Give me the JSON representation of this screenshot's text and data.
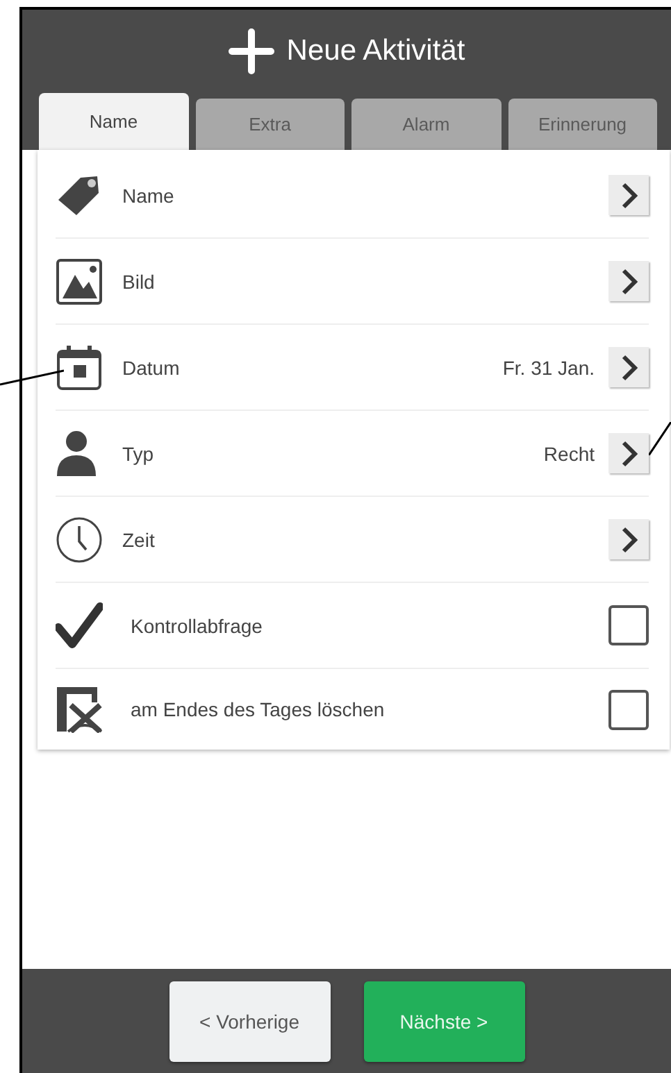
{
  "header": {
    "title": "Neue Aktivität"
  },
  "tabs": [
    {
      "label": "Name",
      "selected": true
    },
    {
      "label": "Extra",
      "selected": false
    },
    {
      "label": "Alarm",
      "selected": false
    },
    {
      "label": "Erinnerung",
      "selected": false
    }
  ],
  "rows": [
    {
      "kind": "link",
      "label": "Name"
    },
    {
      "kind": "link",
      "label": "Bild"
    },
    {
      "kind": "link",
      "label": "Datum",
      "value": "Fr. 31 Jan."
    },
    {
      "kind": "link",
      "label": "Typ",
      "value": "Recht"
    },
    {
      "kind": "link",
      "label": "Zeit"
    },
    {
      "kind": "check",
      "label": "Kontrollabfrage",
      "checked": false
    },
    {
      "kind": "check",
      "label": "am Endes des Tages löschen",
      "checked": false
    }
  ],
  "footer": {
    "previous": "< Vorherige",
    "next": "Nächste >"
  }
}
